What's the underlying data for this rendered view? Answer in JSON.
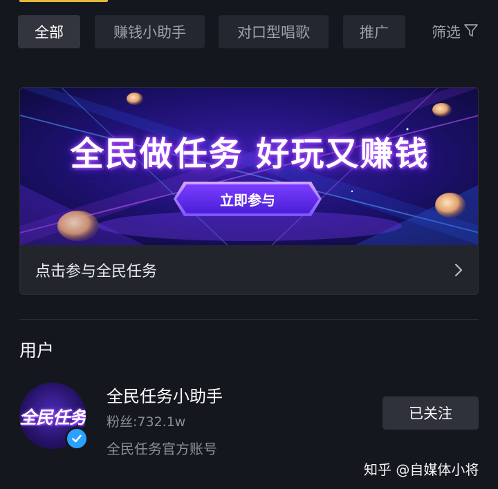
{
  "filters": {
    "chips": [
      "全部",
      "赚钱小助手",
      "对口型唱歌",
      "推广"
    ],
    "active_index": 0,
    "filter_label": "筛选"
  },
  "banner": {
    "headline": "全民做任务  好玩又赚钱",
    "cta_label": "立即参与",
    "link_label": "点击参与全民任务"
  },
  "users_section": {
    "title": "用户",
    "user": {
      "avatar_text": "全民任务",
      "name": "全民任务小助手",
      "fans": "粉丝:732.1w",
      "description": "全民任务官方账号",
      "follow_label": "已关注",
      "verified": true
    }
  },
  "watermark": "知乎 @自媒体小将",
  "colors": {
    "background": "#15171e",
    "accent": "#e5b83a",
    "verified_blue": "#2aa1ff"
  }
}
